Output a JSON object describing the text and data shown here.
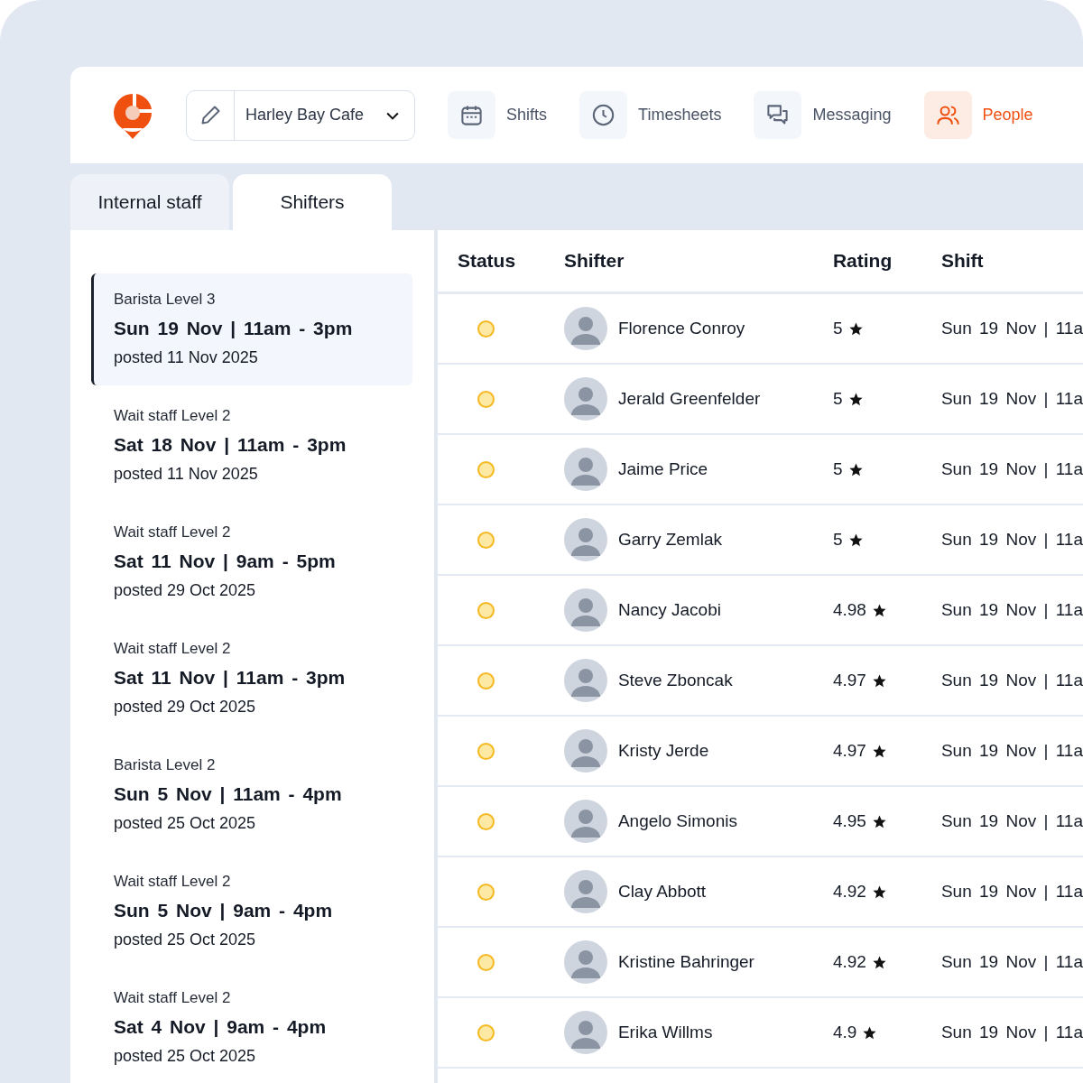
{
  "header": {
    "venue": "Harley Bay Cafe",
    "nav": [
      {
        "kind": "shifts",
        "label": "Shifts",
        "selected": false
      },
      {
        "kind": "timesheets",
        "label": "Timesheets",
        "selected": false
      },
      {
        "kind": "messaging",
        "label": "Messaging",
        "selected": false
      },
      {
        "kind": "people",
        "label": "People",
        "selected": true
      }
    ]
  },
  "tabs": [
    {
      "label": "Internal staff",
      "selected": false
    },
    {
      "label": "Shifters",
      "selected": true
    }
  ],
  "shift_list": [
    {
      "role": "Barista Level 3",
      "when": "Sun 19 Nov | 11am - 3pm",
      "posted": "posted 11 Nov 2025",
      "selected": true
    },
    {
      "role": "Wait staff Level 2",
      "when": "Sat 18 Nov | 11am - 3pm",
      "posted": "posted 11 Nov 2025",
      "selected": false
    },
    {
      "role": "Wait staff Level 2",
      "when": "Sat 11 Nov | 9am - 5pm",
      "posted": "posted 29 Oct 2025",
      "selected": false
    },
    {
      "role": "Wait staff Level 2",
      "when": "Sat 11 Nov | 11am - 3pm",
      "posted": "posted 29 Oct 2025",
      "selected": false
    },
    {
      "role": "Barista Level 2",
      "when": "Sun 5 Nov | 11am - 4pm",
      "posted": "posted 25 Oct 2025",
      "selected": false
    },
    {
      "role": "Wait staff Level 2",
      "when": "Sun 5 Nov | 9am - 4pm",
      "posted": "posted 25 Oct 2025",
      "selected": false
    },
    {
      "role": "Wait staff Level 2",
      "when": "Sat 4 Nov | 9am - 4pm",
      "posted": "posted 25 Oct 2025",
      "selected": false
    }
  ],
  "table": {
    "columns": [
      "Status",
      "Shifter",
      "Rating",
      "Shift"
    ],
    "rows": [
      {
        "color": "#fde8a4",
        "name": "Florence Conroy",
        "rating": "5",
        "shift": "Sun 19 Nov | 11a"
      },
      {
        "color": "#fde8a4",
        "name": "Jerald Greenfelder",
        "rating": "5",
        "shift": "Sun 19 Nov | 11a"
      },
      {
        "color": "#fde8a4",
        "name": "Jaime Price",
        "rating": "5",
        "shift": "Sun 19 Nov | 11a"
      },
      {
        "color": "#fde8a4",
        "name": "Garry Zemlak",
        "rating": "5",
        "shift": "Sun 19 Nov | 11a"
      },
      {
        "color": "#fde8a4",
        "name": "Nancy Jacobi",
        "rating": "4.98",
        "shift": "Sun 19 Nov | 11a"
      },
      {
        "color": "#fde8a4",
        "name": "Steve Zboncak",
        "rating": "4.97",
        "shift": "Sun 19 Nov | 11a"
      },
      {
        "color": "#fde8a4",
        "name": "Kristy Jerde",
        "rating": "4.97",
        "shift": "Sun 19 Nov | 11a"
      },
      {
        "color": "#fde8a4",
        "name": "Angelo Simonis",
        "rating": "4.95",
        "shift": "Sun 19 Nov | 11a"
      },
      {
        "color": "#fde8a4",
        "name": "Clay Abbott",
        "rating": "4.92",
        "shift": "Sun 19 Nov | 11a"
      },
      {
        "color": "#fde8a4",
        "name": "Kristine Bahringer",
        "rating": "4.92",
        "shift": "Sun 19 Nov | 11a"
      },
      {
        "color": "#fde8a4",
        "name": "Erika Willms",
        "rating": "4.9",
        "shift": "Sun 19 Nov | 11a"
      }
    ]
  }
}
